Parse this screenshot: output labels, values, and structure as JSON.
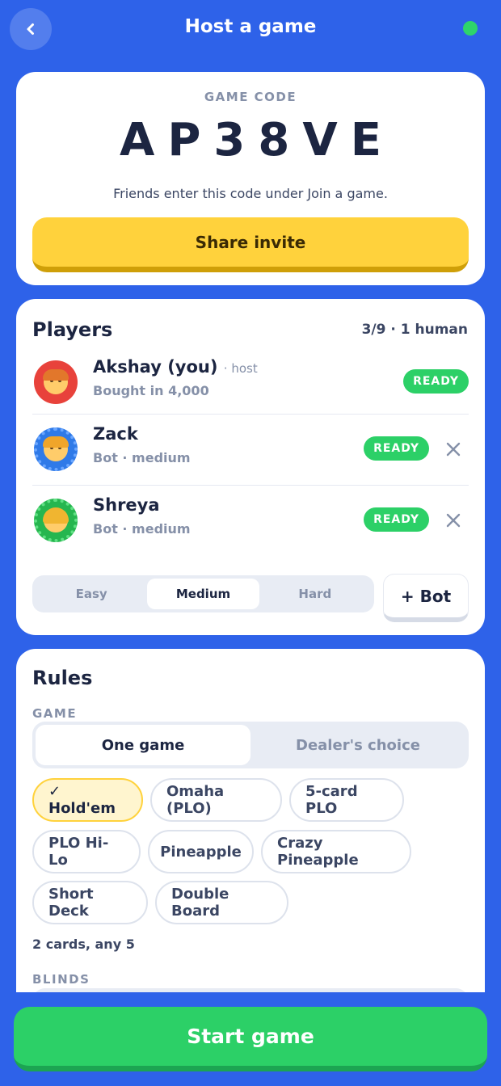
{
  "header": {
    "title": "Host a game",
    "status_color": "#2ed46b"
  },
  "code_card": {
    "label": "GAME CODE",
    "code": "AP38VE",
    "hint": "Friends enter this code under Join a game.",
    "share_label": "Share invite"
  },
  "players": {
    "title": "Players",
    "count": "3/9 · 1 human",
    "list": [
      {
        "name": "Akshay (you)",
        "tag": "· host",
        "sub": "Bought in 4,000",
        "status": "READY",
        "avatar": "man-red-hair-emoji",
        "removable": false
      },
      {
        "name": "Zack",
        "tag": "",
        "sub": "Bot · medium",
        "status": "READY",
        "avatar": "man-blond-emoji",
        "removable": true
      },
      {
        "name": "Shreya",
        "tag": "",
        "sub": "Bot · medium",
        "status": "READY",
        "avatar": "woman-blond-emoji",
        "removable": true
      }
    ],
    "difficulty": {
      "options": [
        "Easy",
        "Medium",
        "Hard"
      ],
      "selected": "Medium"
    },
    "add_bot_label": "+ Bot"
  },
  "rules": {
    "title": "Rules",
    "game_label": "GAME",
    "game_mode": {
      "options": [
        "One game",
        "Dealer's choice"
      ],
      "selected": "One game"
    },
    "variants": [
      "✓ Hold'em",
      "Omaha (PLO)",
      "5-card PLO",
      "PLO Hi-Lo",
      "Pineapple",
      "Crazy Pineapple",
      "Short Deck",
      "Double Board"
    ],
    "selected_variant": "✓ Hold'em",
    "variant_desc": "2 cards, any 5",
    "blinds_label": "BLINDS"
  },
  "footer": {
    "start_label": "Start game"
  },
  "colors": {
    "background": "#2e62e9",
    "accent_yellow": "#ffd23c",
    "ready_green": "#2cd067"
  }
}
